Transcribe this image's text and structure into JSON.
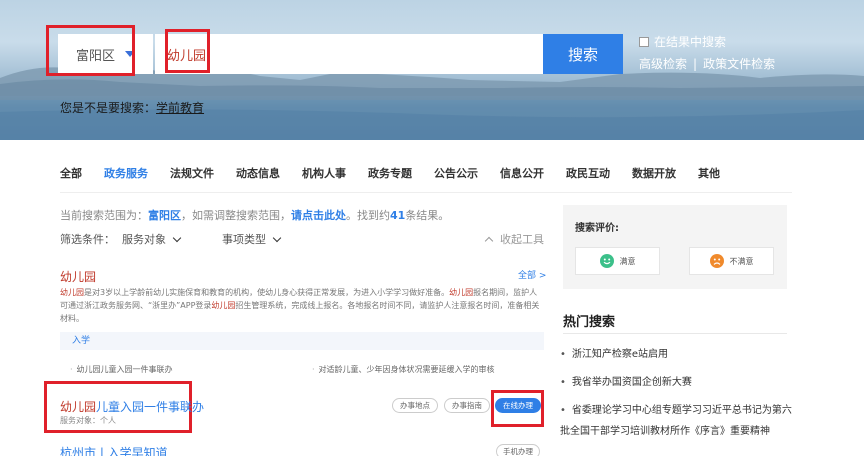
{
  "search": {
    "region": "富阳区",
    "query": "幼儿园",
    "button_label": "搜索",
    "in_result_label": "在结果中搜索",
    "advanced_label": "高级检索",
    "separator": "|",
    "policy_label": "政策文件检索",
    "suggest_prefix": "您是不是要搜索：",
    "suggest_term": "学前教育"
  },
  "tabs": [
    {
      "label": "全部",
      "active": false
    },
    {
      "label": "政务服务",
      "active": true
    },
    {
      "label": "法规文件",
      "active": false
    },
    {
      "label": "动态信息",
      "active": false
    },
    {
      "label": "机构人事",
      "active": false
    },
    {
      "label": "政务专题",
      "active": false
    },
    {
      "label": "公告公示",
      "active": false
    },
    {
      "label": "信息公开",
      "active": false
    },
    {
      "label": "政民互动",
      "active": false
    },
    {
      "label": "数据开放",
      "active": false
    },
    {
      "label": "其他",
      "active": false
    }
  ],
  "scope": {
    "p1": "当前搜索范围为：",
    "region": "富阳区",
    "p2": "，如需调整搜索范围，",
    "link": "请点击此处",
    "p3": "。找到约",
    "count": "41",
    "p4": "条结果。"
  },
  "filters": {
    "label": "筛选条件：",
    "service_target": "服务对象",
    "item_type": "事项类型",
    "collapse": "收起工具"
  },
  "result": {
    "title": "幼儿园",
    "more": "全部 >",
    "desc_1": "幼儿园",
    "desc_2": "是对3岁以上学龄前幼儿实施保育和教育的机构，使幼儿身心获得正常发展，为进入小学学习做好准备。",
    "desc_3": "幼儿园",
    "desc_4": "报名期间，监护人可通过浙江政务服务网、“浙里办”APP登录",
    "desc_5": "幼儿园",
    "desc_6": "招生管理系统，完成线上报名。各地报名时间不同，请监护人注意报名时间，准备相关材料。",
    "category": "入学",
    "sub_items": [
      "幼儿园儿童入园一件事联办",
      "对适龄儿童、少年因身体状况需要延缓入学的审核"
    ]
  },
  "service": {
    "title_kw": "幼儿园",
    "title_rest": "儿童入园一件事联办",
    "target": "服务对象：个人",
    "btn_location": "办事地点",
    "btn_guide": "办事指南",
    "btn_online": "在线办理"
  },
  "next": {
    "title": "杭州市 | 入学早知道",
    "btn_mobile": "手机办理"
  },
  "evaluation": {
    "title": "搜索评价:",
    "satisfied": "满意",
    "unsatisfied": "不满意"
  },
  "hot": {
    "title": "热门搜索",
    "items": [
      "浙江知产检察e站启用",
      "我省举办国资国企创新大赛",
      "省委理论学习中心组专题学习习近平总书记为第六批全国干部学习培训教材所作《序言》重要精神"
    ]
  },
  "colors": {
    "accent_blue": "#2f7fe6",
    "keyword_red": "#c03a2b",
    "highlight_box": "#e0202a"
  }
}
